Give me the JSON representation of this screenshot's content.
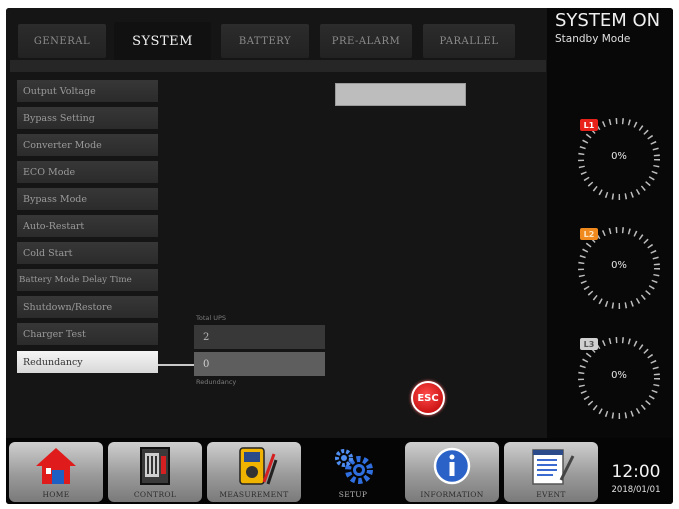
{
  "tabs": [
    {
      "label": "GENERAL",
      "active": false
    },
    {
      "label": "SYSTEM",
      "active": true
    },
    {
      "label": "BATTERY",
      "active": false
    },
    {
      "label": "PRE-ALARM",
      "active": false
    },
    {
      "label": "PARALLEL",
      "active": false
    }
  ],
  "menu": [
    {
      "label": "Output Voltage"
    },
    {
      "label": "Bypass Setting"
    },
    {
      "label": "Converter Mode"
    },
    {
      "label": "ECO Mode"
    },
    {
      "label": "Bypass Mode"
    },
    {
      "label": "Auto-Restart"
    },
    {
      "label": "Cold Start"
    },
    {
      "label": "Battery Mode Delay Time"
    },
    {
      "label": "Shutdown/Restore"
    },
    {
      "label": "Charger Test"
    },
    {
      "label": "Redundancy",
      "active": true
    }
  ],
  "redundancy": {
    "total_ups_label": "Total UPS",
    "total_ups_value": "2",
    "redundancy_value": "0",
    "redundancy_label": "Redundancy"
  },
  "esc_label": "ESC",
  "status": {
    "title": "SYSTEM ON",
    "mode": "Standby Mode"
  },
  "gauges": [
    {
      "label": "L1",
      "value": "0%",
      "color": "#e8221b"
    },
    {
      "label": "L2",
      "value": "0%",
      "color": "#f08a1e"
    },
    {
      "label": "L3",
      "value": "0%",
      "color": "#c8c8c8"
    }
  ],
  "nav": [
    {
      "label": "HOME",
      "icon": "home-icon"
    },
    {
      "label": "CONTROL",
      "icon": "control-icon"
    },
    {
      "label": "MEASUREMENT",
      "icon": "multimeter-icon"
    },
    {
      "label": "SETUP",
      "icon": "gears-icon",
      "active": true
    },
    {
      "label": "INFORMATION",
      "icon": "info-icon"
    },
    {
      "label": "EVENT",
      "icon": "event-log-icon"
    }
  ],
  "clock": {
    "time": "12:00",
    "date": "2018/01/01"
  },
  "colors": {
    "accent_red": "#d81515",
    "active_item": "#eeeeee",
    "setup_blue": "#2f6fe0"
  }
}
